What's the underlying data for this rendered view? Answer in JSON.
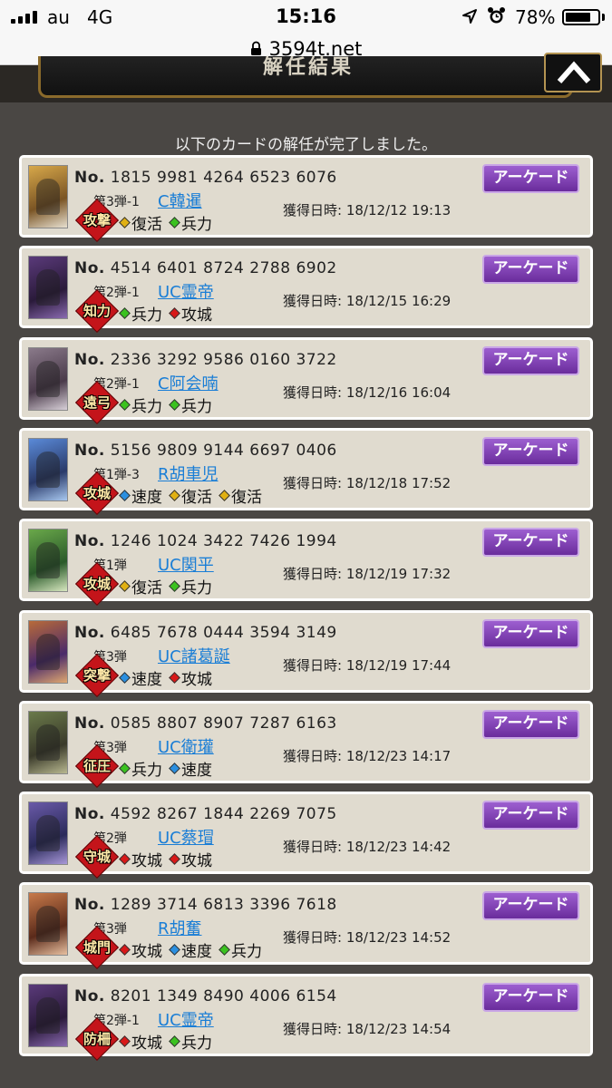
{
  "status_bar": {
    "carrier": "au",
    "network": "4G",
    "time": "15:16",
    "battery_pct": "78%",
    "battery_level": 0.78
  },
  "url_bar": {
    "url": "3594t.net"
  },
  "header": {
    "title": "解任結果"
  },
  "message": "以下のカードの解任が完了しました。",
  "colors": {
    "skill_gold": "#e0b012",
    "skill_green": "#3bc21f",
    "skill_red": "#d81818",
    "skill_blue": "#2a8fe0",
    "button_purple": "#7b3aae",
    "badge_red": "#c4141a"
  },
  "cards": [
    {
      "no_label": "No.",
      "number": "1815 9981 4264 6523 6076",
      "edition": "第3弾-1",
      "name": "C韓暹",
      "badge": "攻撃",
      "skills": [
        {
          "name": "復活",
          "gem": "gold"
        },
        {
          "name": "兵力",
          "gem": "green"
        }
      ],
      "date": "獲得日時: 18/12/12 19:13",
      "button": "アーケード"
    },
    {
      "no_label": "No.",
      "number": "4514 6401 8724 2788 6902",
      "edition": "第2弾-1",
      "name": "UC霊帝",
      "badge": "知力",
      "skills": [
        {
          "name": "兵力",
          "gem": "green"
        },
        {
          "name": "攻城",
          "gem": "red"
        }
      ],
      "date": "獲得日時: 18/12/15 16:29",
      "button": "アーケード"
    },
    {
      "no_label": "No.",
      "number": "2336 3292 9586 0160 3722",
      "edition": "第2弾-1",
      "name": "C阿会喃",
      "badge": "遠弓",
      "skills": [
        {
          "name": "兵力",
          "gem": "green"
        },
        {
          "name": "兵力",
          "gem": "green"
        }
      ],
      "date": "獲得日時: 18/12/16 16:04",
      "button": "アーケード"
    },
    {
      "no_label": "No.",
      "number": "5156 9809 9144 6697 0406",
      "edition": "第1弾-3",
      "name": "R胡車児",
      "badge": "攻城",
      "skills": [
        {
          "name": "速度",
          "gem": "blue"
        },
        {
          "name": "復活",
          "gem": "gold"
        },
        {
          "name": "復活",
          "gem": "gold"
        }
      ],
      "date": "獲得日時: 18/12/18 17:52",
      "button": "アーケード"
    },
    {
      "no_label": "No.",
      "number": "1246 1024 3422 7426 1994",
      "edition": "第1弾",
      "name": "UC関平",
      "badge": "攻城",
      "skills": [
        {
          "name": "復活",
          "gem": "gold"
        },
        {
          "name": "兵力",
          "gem": "green"
        }
      ],
      "date": "獲得日時: 18/12/19 17:32",
      "button": "アーケード"
    },
    {
      "no_label": "No.",
      "number": "6485 7678 0444 3594 3149",
      "edition": "第3弾",
      "name": "UC諸葛誕",
      "badge": "突撃",
      "skills": [
        {
          "name": "速度",
          "gem": "blue"
        },
        {
          "name": "攻城",
          "gem": "red"
        }
      ],
      "date": "獲得日時: 18/12/19 17:44",
      "button": "アーケード"
    },
    {
      "no_label": "No.",
      "number": "0585 8807 8907 7287 6163",
      "edition": "第3弾",
      "name": "UC衛瓘",
      "badge": "征圧",
      "skills": [
        {
          "name": "兵力",
          "gem": "green"
        },
        {
          "name": "速度",
          "gem": "blue"
        }
      ],
      "date": "獲得日時: 18/12/23 14:17",
      "button": "アーケード"
    },
    {
      "no_label": "No.",
      "number": "4592 8267 1844 2269 7075",
      "edition": "第2弾",
      "name": "UC蔡瑁",
      "badge": "守城",
      "skills": [
        {
          "name": "攻城",
          "gem": "red"
        },
        {
          "name": "攻城",
          "gem": "red"
        }
      ],
      "date": "獲得日時: 18/12/23 14:42",
      "button": "アーケード"
    },
    {
      "no_label": "No.",
      "number": "1289 3714 6813 3396 7618",
      "edition": "第3弾",
      "name": "R胡奮",
      "badge": "城門",
      "skills": [
        {
          "name": "攻城",
          "gem": "red"
        },
        {
          "name": "速度",
          "gem": "blue"
        },
        {
          "name": "兵力",
          "gem": "green"
        }
      ],
      "date": "獲得日時: 18/12/23 14:52",
      "button": "アーケード"
    },
    {
      "no_label": "No.",
      "number": "8201 1349 8490 4006 6154",
      "edition": "第2弾-1",
      "name": "UC霊帝",
      "badge": "防柵",
      "skills": [
        {
          "name": "攻城",
          "gem": "red"
        },
        {
          "name": "兵力",
          "gem": "green"
        }
      ],
      "date": "獲得日時: 18/12/23 14:54",
      "button": "アーケード"
    }
  ]
}
